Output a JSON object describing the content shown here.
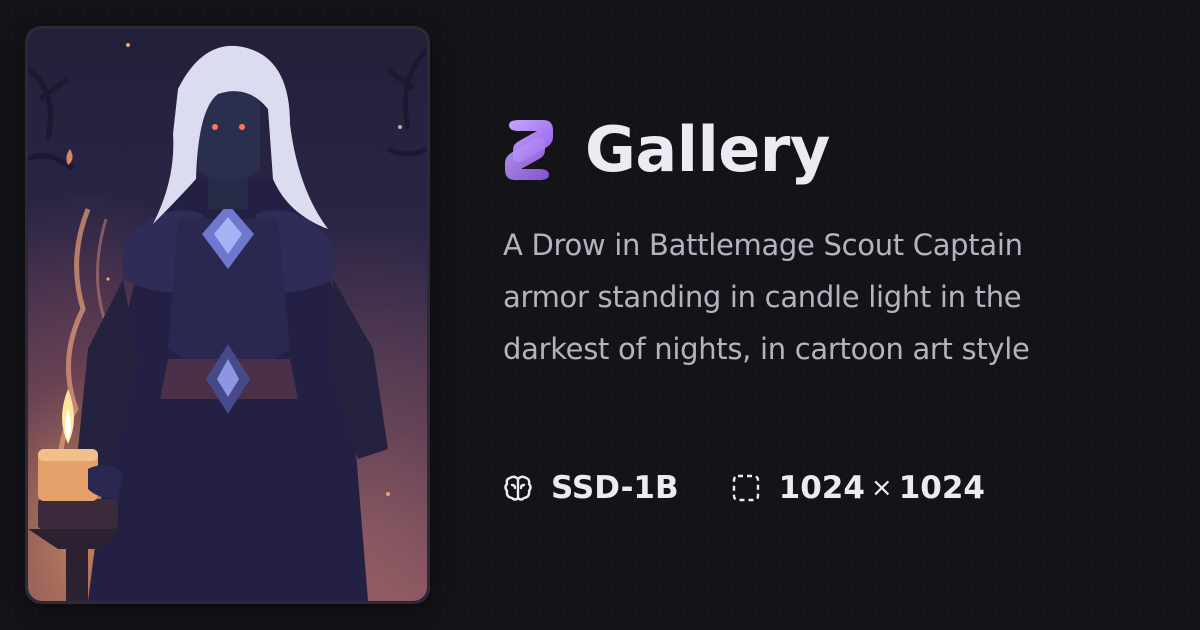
{
  "brand": {
    "title": "Gallery",
    "icon": "gallery-logo-icon",
    "icon_color": "#a67cf0"
  },
  "artwork": {
    "description_hidden": ""
  },
  "prompt": {
    "text": "A Drow in Battlemage Scout Captain armor standing in candle light in the darkest of nights, in cartoon art style"
  },
  "meta": {
    "model_icon": "brain-icon",
    "model": "SSD-1B",
    "dimensions_icon": "dashed-square-icon",
    "width": "1024",
    "separator": "×",
    "height": "1024"
  },
  "colors": {
    "background": "#141318",
    "title": "#ecebf3",
    "prompt": "#b5b3c0",
    "accent": "#a67cf0"
  }
}
